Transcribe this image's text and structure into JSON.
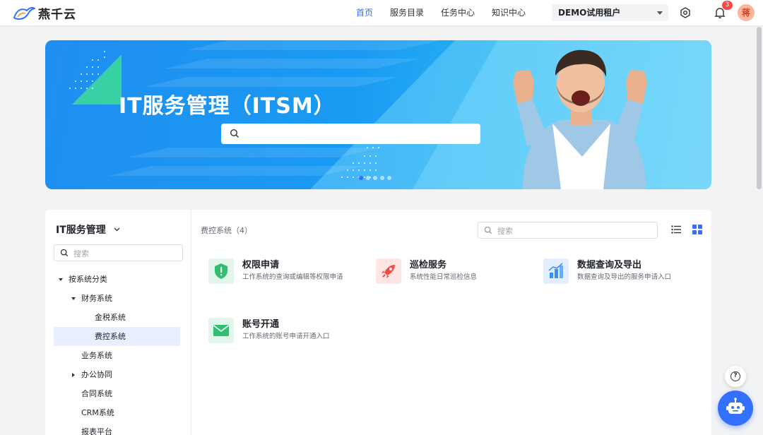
{
  "header": {
    "logo_text": "燕千云",
    "nav": [
      {
        "label": "首页",
        "active": true
      },
      {
        "label": "服务目录",
        "active": false
      },
      {
        "label": "任务中心",
        "active": false
      },
      {
        "label": "知识中心",
        "active": false
      }
    ],
    "tenant": "DEMO试用租户",
    "notification_count": "3",
    "avatar_text": "蒋"
  },
  "banner": {
    "title": "IT服务管理（ITSM）",
    "search_placeholder": "",
    "slides": 5,
    "active_slide": 0
  },
  "sidebar": {
    "title": "IT服务管理",
    "search_placeholder": "搜索",
    "tree": [
      {
        "label": "按系统分类",
        "level": 0,
        "arrow": "down"
      },
      {
        "label": "财务系统",
        "level": 1,
        "arrow": "down"
      },
      {
        "label": "金税系统",
        "level": 2,
        "arrow": ""
      },
      {
        "label": "费控系统",
        "level": 2,
        "arrow": "",
        "selected": true
      },
      {
        "label": "业务系统",
        "level": 1,
        "arrow": ""
      },
      {
        "label": "办公协同",
        "level": 1,
        "arrow": "right"
      },
      {
        "label": "合同系统",
        "level": 1,
        "arrow": ""
      },
      {
        "label": "CRM系统",
        "level": 1,
        "arrow": ""
      },
      {
        "label": "报表平台",
        "level": 1,
        "arrow": ""
      }
    ]
  },
  "content": {
    "breadcrumb": "费控系统（4）",
    "search_placeholder": "搜索",
    "cards": [
      {
        "title": "权限申请",
        "desc": "工作系统的查询或编辑等权限申请",
        "icon": "shield-icon",
        "color": "#2fbf71"
      },
      {
        "title": "巡检服务",
        "desc": "系统性能日常巡检信息",
        "icon": "rocket-icon",
        "color": "#f54a45"
      },
      {
        "title": "数据查询及导出",
        "desc": "数据查询及导出的服务申请入口",
        "icon": "bar-chart-icon",
        "color": "#3a8ef6"
      },
      {
        "title": "账号开通",
        "desc": "工作系统的账号申请开通入口",
        "icon": "mail-icon",
        "color": "#2fbf71"
      }
    ]
  },
  "colors": {
    "accent": "#3370ff",
    "badge": "#f54a45",
    "banner": "#1a9af3"
  }
}
